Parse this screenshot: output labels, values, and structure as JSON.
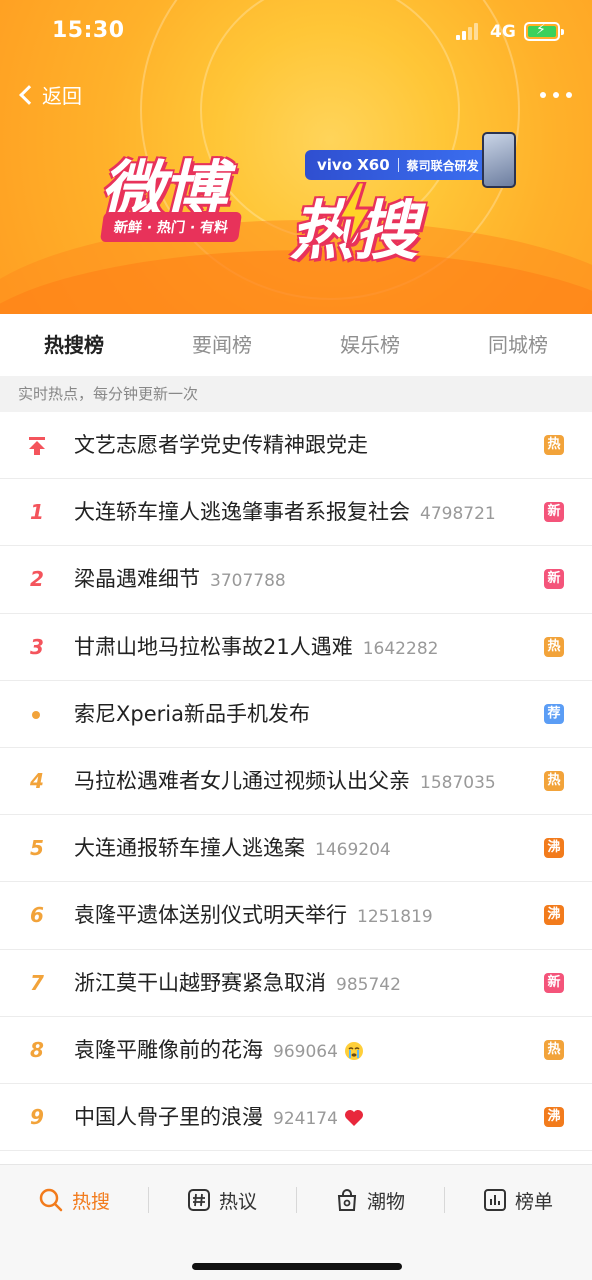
{
  "status_bar": {
    "time": "15:30",
    "network": "4G"
  },
  "header": {
    "back_label": "返回",
    "logo_text_1": "微博",
    "logo_text_2": "热搜",
    "slogan": "新鲜 · 热门 · 有料",
    "sponsor_brand": "vivo X60",
    "sponsor_note": "蔡司联合研发",
    "colors": {
      "banner": "#ffb12a",
      "logo_accent": "#e8325a",
      "sponsor": "#2f4fd0"
    }
  },
  "tabs": [
    {
      "label": "热搜榜",
      "active": true
    },
    {
      "label": "要闻榜",
      "active": false
    },
    {
      "label": "娱乐榜",
      "active": false
    },
    {
      "label": "同城榜",
      "active": false
    }
  ],
  "notice": "实时热点，每分钟更新一次",
  "list": [
    {
      "rank": "",
      "kind": "pinned",
      "icon": "pin-up-icon",
      "title": "文艺志愿者学党史传精神跟党走",
      "count": "",
      "emoji": "",
      "badge": "热",
      "badge_color": "#f2a33a"
    },
    {
      "rank": "1",
      "kind": "top3",
      "title": "大连轿车撞人逃逸肇事者系报复社会",
      "count": "4798721",
      "emoji": "",
      "badge": "新",
      "badge_color": "#f4547a"
    },
    {
      "rank": "2",
      "kind": "top3",
      "title": "梁晶遇难细节",
      "count": "3707788",
      "emoji": "",
      "badge": "新",
      "badge_color": "#f4547a"
    },
    {
      "rank": "3",
      "kind": "top3",
      "title": "甘肃山地马拉松事故21人遇难",
      "count": "1642282",
      "emoji": "",
      "badge": "热",
      "badge_color": "#f2a33a"
    },
    {
      "rank": "",
      "kind": "promoted",
      "icon": "dot-icon",
      "title": "索尼Xperia新品手机发布",
      "count": "",
      "emoji": "",
      "badge": "荐",
      "badge_color": "#5b9df5"
    },
    {
      "rank": "4",
      "kind": "rest",
      "title": "马拉松遇难者女儿通过视频认出父亲",
      "count": "1587035",
      "emoji": "",
      "badge": "热",
      "badge_color": "#f2a33a"
    },
    {
      "rank": "5",
      "kind": "rest",
      "title": "大连通报轿车撞人逃逸案",
      "count": "1469204",
      "emoji": "",
      "badge": "沸",
      "badge_color": "#f27b1c"
    },
    {
      "rank": "6",
      "kind": "rest",
      "title": "袁隆平遗体送别仪式明天举行",
      "count": "1251819",
      "emoji": "",
      "badge": "沸",
      "badge_color": "#f27b1c"
    },
    {
      "rank": "7",
      "kind": "rest",
      "title": "浙江莫干山越野赛紧急取消",
      "count": "985742",
      "emoji": "",
      "badge": "新",
      "badge_color": "#f4547a"
    },
    {
      "rank": "8",
      "kind": "rest",
      "title": "袁隆平雕像前的花海",
      "count": "969064",
      "emoji": "crying-face-icon",
      "badge": "热",
      "badge_color": "#f2a33a"
    },
    {
      "rank": "9",
      "kind": "rest",
      "title": "中国人骨子里的浪漫",
      "count": "924174",
      "emoji": "heart-icon",
      "badge": "沸",
      "badge_color": "#f27b1c"
    }
  ],
  "bottom_nav": [
    {
      "label": "热搜",
      "icon": "search-icon",
      "active": true
    },
    {
      "label": "热议",
      "icon": "hashtag-icon",
      "active": false
    },
    {
      "label": "潮物",
      "icon": "bag-icon",
      "active": false
    },
    {
      "label": "榜单",
      "icon": "chart-icon",
      "active": false
    }
  ]
}
